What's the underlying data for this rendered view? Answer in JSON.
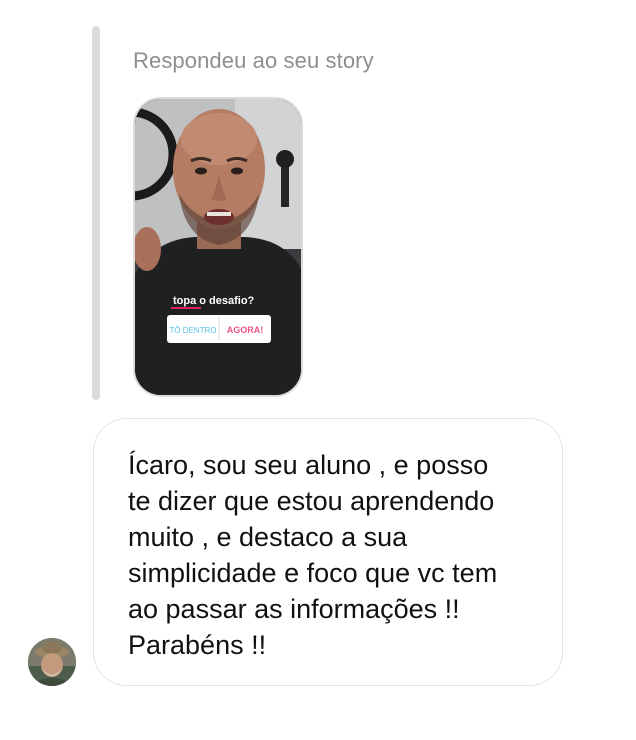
{
  "reply_context": {
    "caption": "Respondeu ao seu story"
  },
  "story": {
    "sticker_question": "topa o desafio?",
    "option_left": "TÔ DENTRO",
    "option_right": "AGORA!",
    "accent_colors": {
      "option_left": "#59c3e6",
      "option_right": "#e8558c",
      "underline": "#e0245e"
    }
  },
  "message": {
    "lines": [
      "Ícaro, sou seu aluno , e posso",
      "te dizer que estou aprendendo",
      "muito , e destaco a sua",
      "simplicidade e foco que vc tem",
      "ao passar as informações !!",
      "Parabéns !!"
    ]
  },
  "sender": {
    "avatar_icon": "user-avatar"
  }
}
